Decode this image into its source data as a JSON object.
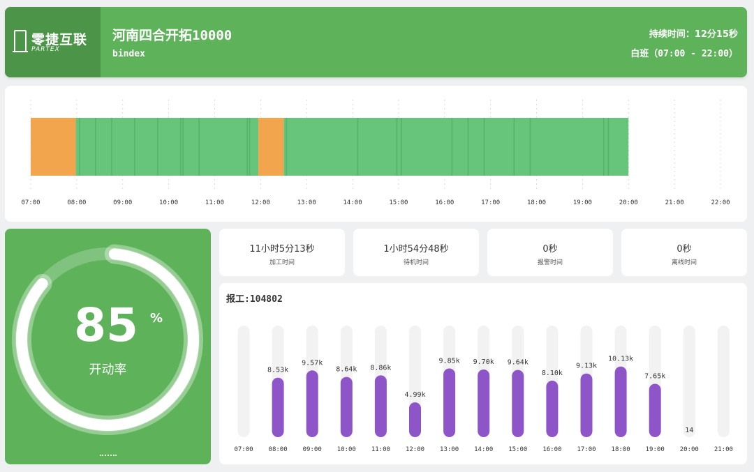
{
  "header": {
    "logo_cn": "零捷互联",
    "logo_en": "PARTEX",
    "title": "河南四合开拓10000",
    "subtitle": "bindex",
    "duration": "持续时间：12分15秒",
    "shift": "白班（07:00 - 22:00）"
  },
  "timeline": {
    "start_hour": 7,
    "end_hour": 22,
    "ticks": [
      "07:00",
      "08:00",
      "09:00",
      "10:00",
      "11:00",
      "12:00",
      "13:00",
      "14:00",
      "15:00",
      "16:00",
      "17:00",
      "18:00",
      "19:00",
      "20:00",
      "21:00",
      "22:00"
    ],
    "colors": {
      "running": "#66c57a",
      "idle": "#f2a54c",
      "running_edge": "#4fae63"
    },
    "segments": [
      {
        "state": "idle",
        "start": 7.0,
        "end": 7.98
      },
      {
        "state": "running",
        "start": 7.98,
        "end": 11.95
      },
      {
        "state": "idle",
        "start": 11.95,
        "end": 12.5
      },
      {
        "state": "running",
        "start": 12.5,
        "end": 20.0
      }
    ],
    "idle_marks": [
      8.05,
      8.4,
      8.75,
      9.25,
      9.75,
      10.25,
      10.3,
      10.65,
      11.7,
      11.75,
      12.55,
      14.1,
      14.95,
      15.05,
      16.15,
      16.5,
      16.85,
      17.5,
      17.85,
      19.45,
      19.55
    ]
  },
  "gauge": {
    "value": "85",
    "percent": 0.85,
    "unit": "%",
    "label": "开动率"
  },
  "stats": [
    {
      "value": "11小时5分13秒",
      "label": "加工时间"
    },
    {
      "value": "1小时54分48秒",
      "label": "待机时间"
    },
    {
      "value": "0秒",
      "label": "报警时间"
    },
    {
      "value": "0秒",
      "label": "离线时间"
    }
  ],
  "chart_data": {
    "type": "bar",
    "title": "报工:104802",
    "categories": [
      "07:00",
      "08:00",
      "09:00",
      "10:00",
      "11:00",
      "12:00",
      "13:00",
      "14:00",
      "15:00",
      "16:00",
      "17:00",
      "18:00",
      "19:00",
      "20:00",
      "21:00"
    ],
    "values": [
      0,
      8530,
      9570,
      8640,
      8860,
      4990,
      9850,
      9700,
      9640,
      8100,
      9130,
      10130,
      7650,
      14,
      0
    ],
    "labels": [
      "",
      "8.53k",
      "9.57k",
      "8.64k",
      "8.86k",
      "4.99k",
      "9.85k",
      "9.70k",
      "9.64k",
      "8.10k",
      "9.13k",
      "10.13k",
      "7.65k",
      "14",
      ""
    ],
    "ylim": [
      0,
      16000
    ],
    "colors": {
      "bar": "#8e55c9",
      "track": "#f2f2f2"
    }
  }
}
